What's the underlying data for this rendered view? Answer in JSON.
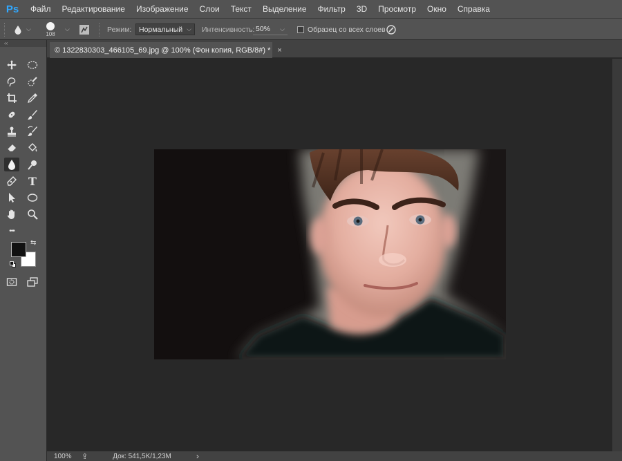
{
  "app": {
    "logo": "Ps"
  },
  "menu": [
    "Файл",
    "Редактирование",
    "Изображение",
    "Слои",
    "Текст",
    "Выделение",
    "Фильтр",
    "3D",
    "Просмотр",
    "Окно",
    "Справка"
  ],
  "options": {
    "brush_size": "108",
    "mode_label": "Режим:",
    "mode_value": "Нормальный",
    "intensity_label": "Интенсивность:",
    "intensity_value": "50%",
    "sample_all_label": "Образец со всех слоев"
  },
  "document": {
    "tab_title": "© 1322830303_466105_69.jpg @ 100% (Фон копия, RGB/8#) *",
    "close_glyph": "×"
  },
  "status": {
    "zoom": "100%",
    "doc_info": "Док: 541,5K/1,23M",
    "arrow": "›"
  },
  "toolbox": {
    "tools": [
      "move-tool",
      "marquee-tool",
      "lasso-tool",
      "quick-select-tool",
      "crop-tool",
      "eyedropper-tool",
      "healing-tool",
      "brush-tool",
      "stamp-tool",
      "history-brush-tool",
      "eraser-tool",
      "paint-bucket-tool",
      "blur-tool",
      "dodge-tool",
      "pen-tool",
      "type-tool",
      "path-select-tool",
      "shape-tool",
      "hand-tool",
      "zoom-tool",
      "more-tools",
      "quick-mask",
      "screen-mode"
    ],
    "type_glyph": "T",
    "more_glyph": "•••",
    "active_tool": "blur-tool"
  },
  "colors": {
    "foreground": "#111111",
    "background": "#ffffff",
    "accent": "#31a8ff"
  }
}
